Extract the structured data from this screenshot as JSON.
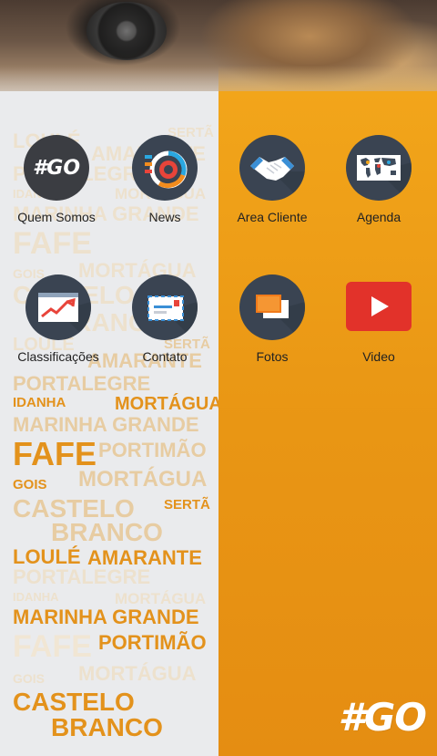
{
  "menu": {
    "items": [
      {
        "label": "Quem Somos",
        "icon": "go-logo-icon"
      },
      {
        "label": "News",
        "icon": "chart-ring-icon"
      },
      {
        "label": "Area Cliente",
        "icon": "handshake-icon"
      },
      {
        "label": "Agenda",
        "icon": "world-map-icon"
      },
      {
        "label": "Classificações",
        "icon": "trend-chart-icon"
      },
      {
        "label": "Contato",
        "icon": "envelope-icon"
      },
      {
        "label": "Fotos",
        "icon": "photos-icon"
      },
      {
        "label": "Video",
        "icon": "youtube-play-icon"
      }
    ]
  },
  "icon_text": {
    "go": "#GO"
  },
  "brand": {
    "logo_text": "#GO"
  },
  "word_cloud": {
    "loule": "LOULÉ",
    "amarante": "AMARANTE",
    "serta": "SERTÃ",
    "portalegre": "PORTALEGRE",
    "idanha": "IDANHA",
    "mortagua": "MORTÁGUA",
    "marinha_grande": "MARINHA GRANDE",
    "fafe": "FAFE",
    "gois": "GOIS",
    "castelo": "CASTELO",
    "branco": "BRANCO",
    "portimao": "PORTIMÃO"
  },
  "colors": {
    "orange": "#e99614",
    "icon_bg": "#3a4452",
    "youtube_red": "#e2322a"
  }
}
